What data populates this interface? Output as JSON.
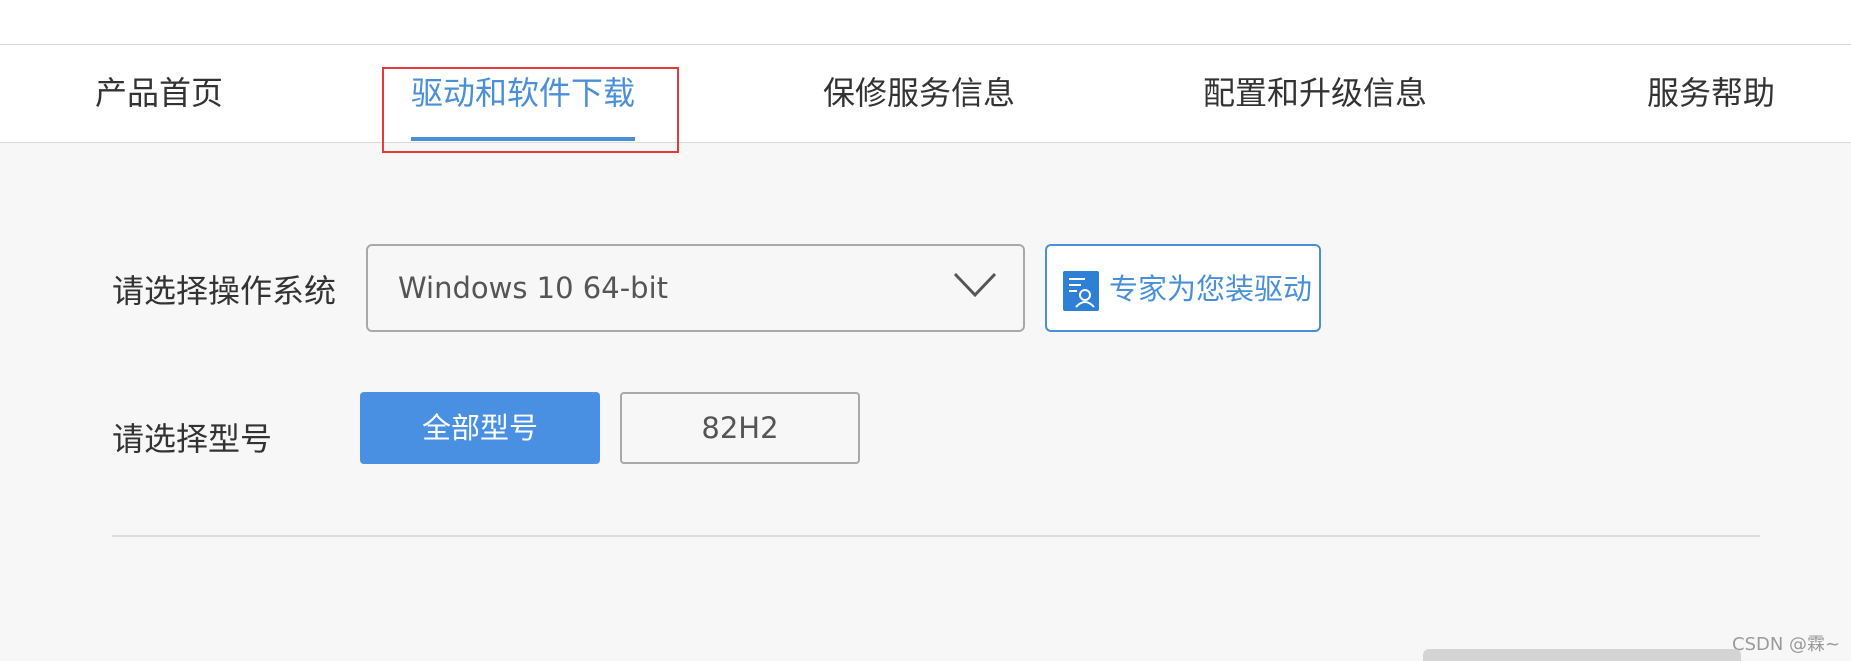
{
  "nav": {
    "tabs": [
      {
        "label": "产品首页",
        "active": false
      },
      {
        "label": "驱动和软件下载",
        "active": true
      },
      {
        "label": "保修服务信息",
        "active": false
      },
      {
        "label": "配置和升级信息",
        "active": false
      },
      {
        "label": "服务帮助",
        "active": false
      }
    ]
  },
  "os_row": {
    "label": "请选择操作系统",
    "selected_os": "Windows 10 64-bit",
    "expert_button_label": "专家为您装驱动",
    "expert_icon": "document-person-icon"
  },
  "model_row": {
    "label": "请选择型号",
    "buttons": [
      {
        "label": "全部型号",
        "selected": true
      },
      {
        "label": "82H2",
        "selected": false
      }
    ]
  },
  "watermark": "CSDN @霖~",
  "colors": {
    "accent": "#4a90d9",
    "primary_button": "#4a90e2",
    "highlight_border": "#e33a3a"
  }
}
